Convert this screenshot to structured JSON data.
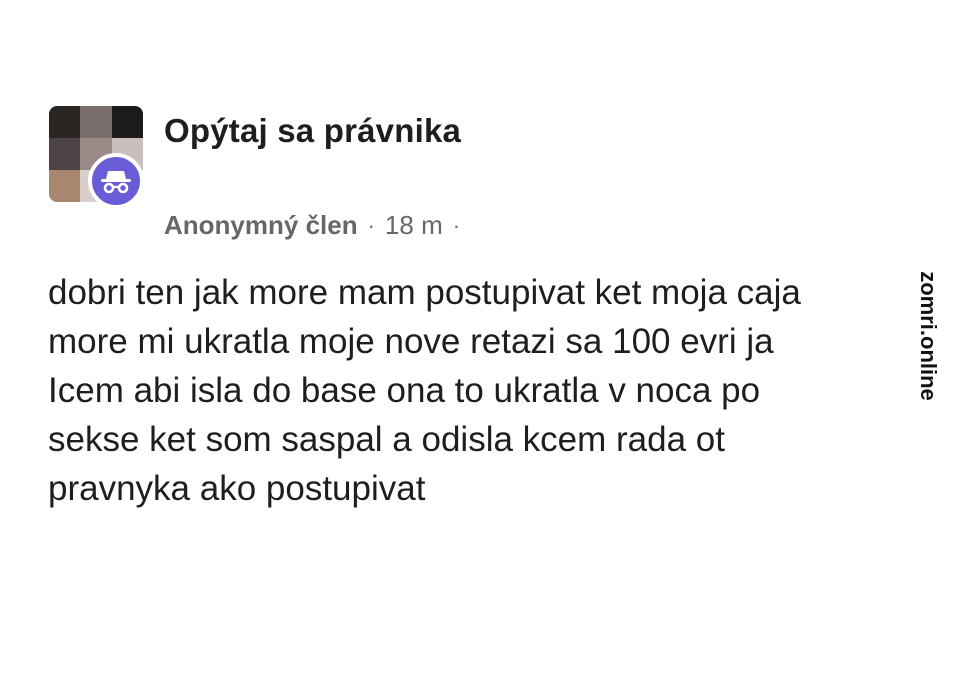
{
  "post": {
    "group_name": "Opýtaj sa právnika",
    "author": "Anonymný člen",
    "separator": "·",
    "time": "18 m",
    "separator_end": "·",
    "body_lines": [
      "dobri ten jak more mam postupivat ket moja caja",
      "more mi ukratla moje nove retazi sa 100 evri ja",
      "Icem abi isla do base ona to ukratla v noca po",
      "sekse ket som saspal a odisla kcem rada ot",
      "pravnyka ako postupivat"
    ]
  },
  "icons": {
    "group_avatar": "pixelated-group-avatar",
    "anonymous_badge": "incognito-icon"
  },
  "colors": {
    "badge": "#6a5bd6",
    "text": "#1c1e21",
    "meta": "#65676b"
  },
  "watermark": "zomri.online"
}
